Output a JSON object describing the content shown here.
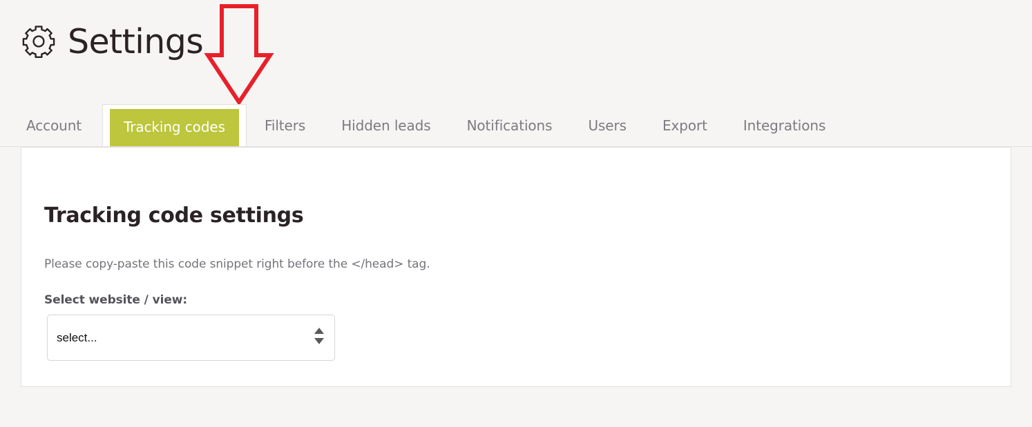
{
  "header": {
    "title": "Settings",
    "icon": "gear-icon"
  },
  "annotation": {
    "type": "down-arrow-icon",
    "color": "#e8202a",
    "points_to": "Tracking codes"
  },
  "tabs": [
    {
      "label": "Account",
      "active": false
    },
    {
      "label": "Tracking codes",
      "active": true
    },
    {
      "label": "Filters",
      "active": false
    },
    {
      "label": "Hidden leads",
      "active": false
    },
    {
      "label": "Notifications",
      "active": false
    },
    {
      "label": "Users",
      "active": false
    },
    {
      "label": "Export",
      "active": false
    },
    {
      "label": "Integrations",
      "active": false
    }
  ],
  "panel": {
    "heading": "Tracking code settings",
    "instruction": "Please copy-paste this code snippet right before the </head> tag.",
    "field": {
      "label": "Select website / view:",
      "value": "select...",
      "indicator_icon": "up-down-chevron-icon"
    }
  },
  "colors": {
    "page_background": "#f6f5f3",
    "panel_background": "#ffffff",
    "active_tab": "#bdc63c",
    "active_tab_text": "#ffffff",
    "inactive_tab_text": "#7e7a82",
    "heading_text": "#2b2226",
    "body_text": "#75727a",
    "label_text": "#55525a",
    "border": "#e2e0de",
    "annotation": "#e8202a"
  }
}
